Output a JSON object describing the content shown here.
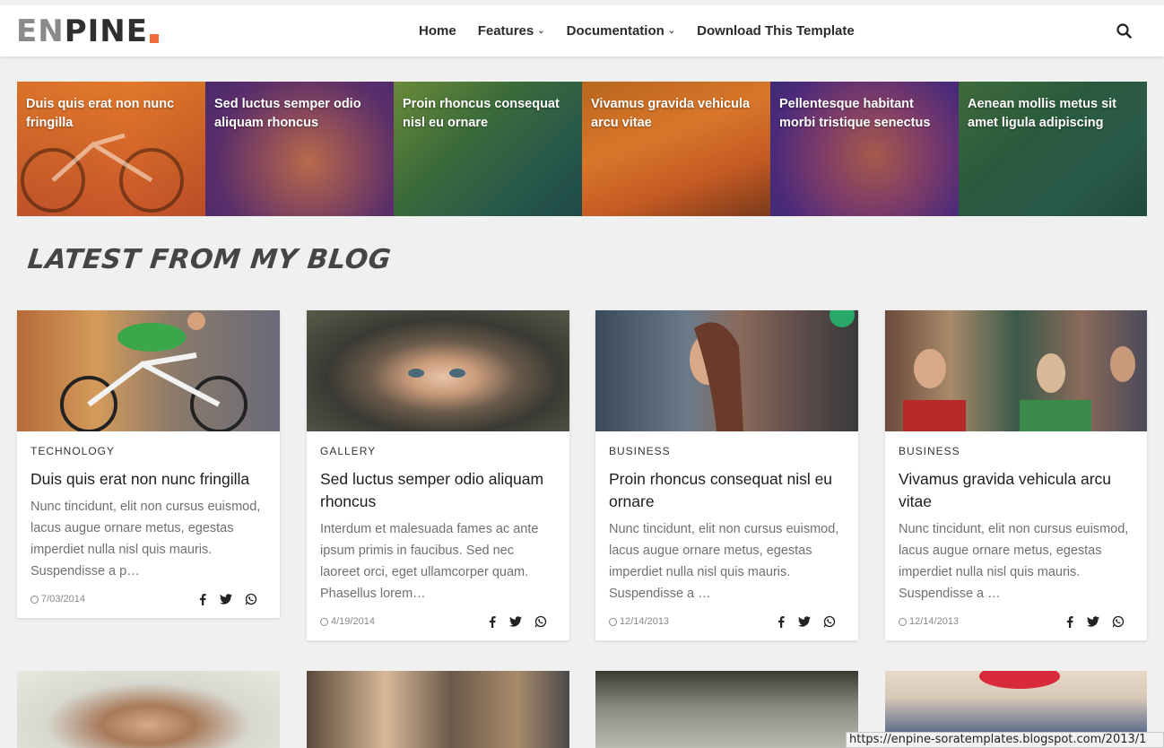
{
  "header": {
    "logo_part1": "EN",
    "logo_part2": "PINE",
    "nav": [
      {
        "label": "Home",
        "dropdown": false
      },
      {
        "label": "Features",
        "dropdown": true
      },
      {
        "label": "Documentation",
        "dropdown": true
      },
      {
        "label": "Download This Template",
        "dropdown": false
      }
    ],
    "search_icon": "search-icon"
  },
  "featured": [
    {
      "title": "Duis quis erat non nunc fringilla"
    },
    {
      "title": "Sed luctus semper odio aliquam rhoncus"
    },
    {
      "title": "Proin rhoncus consequat nisl eu ornare"
    },
    {
      "title": "Vivamus gravida vehicula arcu vitae"
    },
    {
      "title": "Pellentesque habitant morbi tristique senectus"
    },
    {
      "title": "Aenean mollis metus sit amet ligula adipiscing"
    }
  ],
  "section_title": "Latest From My Blog",
  "posts": [
    {
      "category": "Technology",
      "title": "Duis quis erat non nunc fringilla",
      "excerpt": "Nunc tincidunt, elit non cursus euismod, lacus augue ornare metus, egestas imperdiet nulla nisl quis mauris. Suspendisse a p…",
      "date": "7/03/2014"
    },
    {
      "category": "Gallery",
      "title": "Sed luctus semper odio aliquam rhoncus",
      "excerpt": "Interdum et malesuada fames ac ante ipsum primis in faucibus. Sed nec laoreet orci, eget ullamcorper quam. Phasellus lorem…",
      "date": "4/19/2014"
    },
    {
      "category": "Business",
      "title": "Proin rhoncus consequat nisl eu ornare",
      "excerpt": "Nunc tincidunt, elit non cursus euismod, lacus augue ornare metus, egestas imperdiet nulla nisl quis mauris. Suspendisse a …",
      "date": "12/14/2013"
    },
    {
      "category": "Business",
      "title": "Vivamus gravida vehicula arcu vitae",
      "excerpt": "Nunc tincidunt, elit non cursus euismod, lacus augue ornare metus, egestas imperdiet nulla nisl quis mauris. Suspendisse a …",
      "date": "12/14/2013"
    }
  ],
  "status_url": "https://enpine-soratemplates.blogspot.com/2013/1",
  "colors": {
    "accent": "#f26b3a",
    "text": "#2b2b2b",
    "muted": "#707070"
  }
}
